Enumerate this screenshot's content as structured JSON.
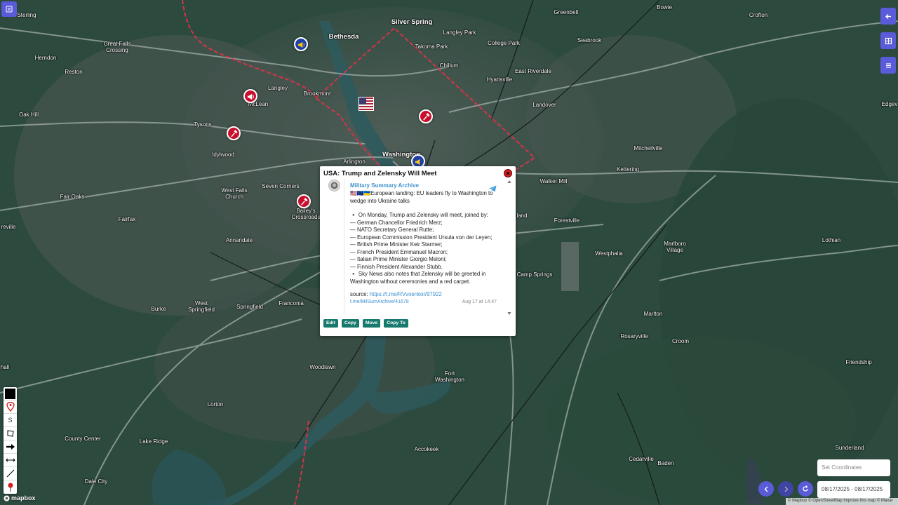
{
  "map": {
    "places": [
      {
        "name": "Sterling",
        "big": false
      },
      {
        "name": "Great Falls\nCrossing",
        "big": false
      },
      {
        "name": "Bethesda",
        "big": true
      },
      {
        "name": "Silver Spring",
        "big": true
      },
      {
        "name": "Langley Park",
        "big": false
      },
      {
        "name": "Greenbelt",
        "big": false
      },
      {
        "name": "Bowie",
        "big": false
      },
      {
        "name": "Crofton",
        "big": false
      },
      {
        "name": "Herndon",
        "big": false
      },
      {
        "name": "Takoma Park",
        "big": false
      },
      {
        "name": "College Park",
        "big": false
      },
      {
        "name": "Seabrook",
        "big": false
      },
      {
        "name": "Reston",
        "big": false
      },
      {
        "name": "Chillum",
        "big": false
      },
      {
        "name": "East Riverdale",
        "big": false
      },
      {
        "name": "Langley",
        "big": false
      },
      {
        "name": "Hyattsville",
        "big": false
      },
      {
        "name": "Brookmont",
        "big": false
      },
      {
        "name": "Oak Hill",
        "big": false
      },
      {
        "name": "McLean",
        "big": false
      },
      {
        "name": "Landover",
        "big": false
      },
      {
        "name": "Tysons",
        "big": false
      },
      {
        "name": "Edgev",
        "big": false
      },
      {
        "name": "Idylwood",
        "big": false
      },
      {
        "name": "Mitchellville",
        "big": false
      },
      {
        "name": "Washington",
        "big": true
      },
      {
        "name": "Arlington",
        "big": false
      },
      {
        "name": "Kettering",
        "big": false
      },
      {
        "name": "Walker Mill",
        "big": false
      },
      {
        "name": "Seven Corners",
        "big": false
      },
      {
        "name": "West Falls\nChurch",
        "big": false
      },
      {
        "name": "Fair Oaks",
        "big": false
      },
      {
        "name": "Bailey's\nCrossroads",
        "big": false
      },
      {
        "name": "Fairfax",
        "big": false
      },
      {
        "name": "reville",
        "big": false
      },
      {
        "name": "Forestville",
        "big": false
      },
      {
        "name": "Lothian",
        "big": false
      },
      {
        "name": "Marlboro\nVillage",
        "big": false
      },
      {
        "name": "Annandale",
        "big": false
      },
      {
        "name": "Westphalia",
        "big": false
      },
      {
        "name": "Camp Springs",
        "big": false
      },
      {
        "name": "Burke",
        "big": false
      },
      {
        "name": "West\nSpringfield",
        "big": false
      },
      {
        "name": "Springfield",
        "big": false
      },
      {
        "name": "Franconia",
        "big": false
      },
      {
        "name": "Marlton",
        "big": false
      },
      {
        "name": "Rosaryville",
        "big": false
      },
      {
        "name": "Croom",
        "big": false
      },
      {
        "name": "Woodlawn",
        "big": false
      },
      {
        "name": "Fort\nWashington",
        "big": false
      },
      {
        "name": "Friendship",
        "big": false
      },
      {
        "name": "hall",
        "big": false
      },
      {
        "name": "Lorton",
        "big": false
      },
      {
        "name": "County Center",
        "big": false
      },
      {
        "name": "Lake Ridge",
        "big": false
      },
      {
        "name": "Accokeek",
        "big": false
      },
      {
        "name": "Sunderland",
        "big": false
      },
      {
        "name": "Cedarville",
        "big": false
      },
      {
        "name": "Baden",
        "big": false
      },
      {
        "name": "Dale City",
        "big": false
      },
      {
        "name": "land",
        "big": false
      }
    ],
    "markers": [
      {
        "kind": "blue",
        "icon": "megaphone-icon"
      },
      {
        "kind": "red",
        "icon": "megaphone-icon"
      },
      {
        "kind": "red",
        "icon": "hammer-icon"
      },
      {
        "kind": "red",
        "icon": "hammer-icon"
      },
      {
        "kind": "red",
        "icon": "hammer-icon"
      },
      {
        "kind": "flag",
        "icon": "us-flag-icon"
      },
      {
        "kind": "blue",
        "icon": "megaphone-icon"
      }
    ]
  },
  "popup": {
    "title": "USA: Trump and Zelensky Will Meet",
    "channel": "Military Summary Archive",
    "lines": [
      "🇺🇸🇪🇺🇺🇦European landing: EU leaders fly to Washington to",
      "wedge into Ukraine talks",
      "",
      "▪️ On Monday, Trump and Zelensky will meet, joined by:",
      "— German Chancellor Friedrich Merz;",
      "— NATO Secretary General Rutte;",
      "— European Commission President Ursula von der Leyen;",
      "— British Prime Minister Keir Starmer;",
      "— French President Emmanuel Macron;",
      "— Italian Prime Minister Giorgio Meloni;",
      "— Finnish President Alexander Stubb.",
      "▪️ Sky News also notes that Zelensky will be greeted in",
      "Washington without ceremonies and a red carpet."
    ],
    "source_label": "source:",
    "source_link": "https://t.me/RVvoenkor/97922",
    "post_link": "t.me/MilSumArchive/41678",
    "post_date": "Aug 17 at 14:47",
    "actions": [
      "Edit",
      "Copy",
      "Move",
      "Copy To"
    ]
  },
  "controls": {
    "coordinates_placeholder": "Set Coordinates",
    "date_range": "08/17/2025 - 08/17/2025",
    "mapbox_label": "mapbox",
    "attribution": "© Mapbox © OpenStreetMap Improve this map © Maxar",
    "toolbar_text_tool": "S"
  },
  "colors": {
    "accent": "#5a5bd8",
    "marker_red": "#c8102e",
    "marker_blue": "#1f3fa8",
    "action_green": "#187a6f",
    "link_blue": "#3d8fce",
    "border_red": "#d6334a"
  }
}
